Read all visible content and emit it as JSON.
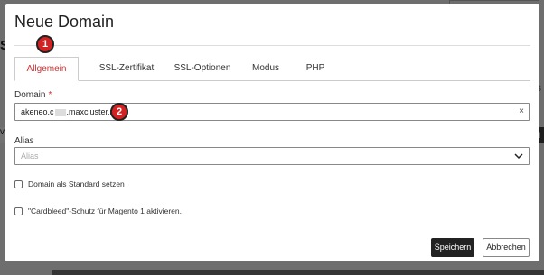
{
  "background": {
    "page_fragment": "S",
    "left_tab_char": "v",
    "right_ls": "LS",
    "right_dark": "N"
  },
  "modal": {
    "title": "Neue Domain",
    "tabs": [
      {
        "label": "Allgemein",
        "active": true
      },
      {
        "label": "SSL-Zertifikat",
        "active": false
      },
      {
        "label": "SSL-Optionen",
        "active": false
      },
      {
        "label": "Modus",
        "active": false
      },
      {
        "label": "PHP",
        "active": false
      }
    ],
    "domain": {
      "label": "Domain",
      "required_mark": "*",
      "value_prefix": "akeneo.c",
      "value_suffix": ".maxcluster.net",
      "clear": "×"
    },
    "alias": {
      "label": "Alias",
      "placeholder": "Alias"
    },
    "checkboxes": [
      {
        "label": "Domain als Standard setzen",
        "checked": false
      },
      {
        "label": "\"Cardbleed\"-Schutz für Magento 1 aktivieren.",
        "checked": false
      }
    ],
    "buttons": {
      "save": "Speichern",
      "cancel": "Abbrechen"
    }
  },
  "annotations": {
    "marker_1": "1",
    "marker_2": "2"
  },
  "colors": {
    "accent_red": "#d03030",
    "marker_red": "#d32222",
    "save_bg": "#222222"
  }
}
